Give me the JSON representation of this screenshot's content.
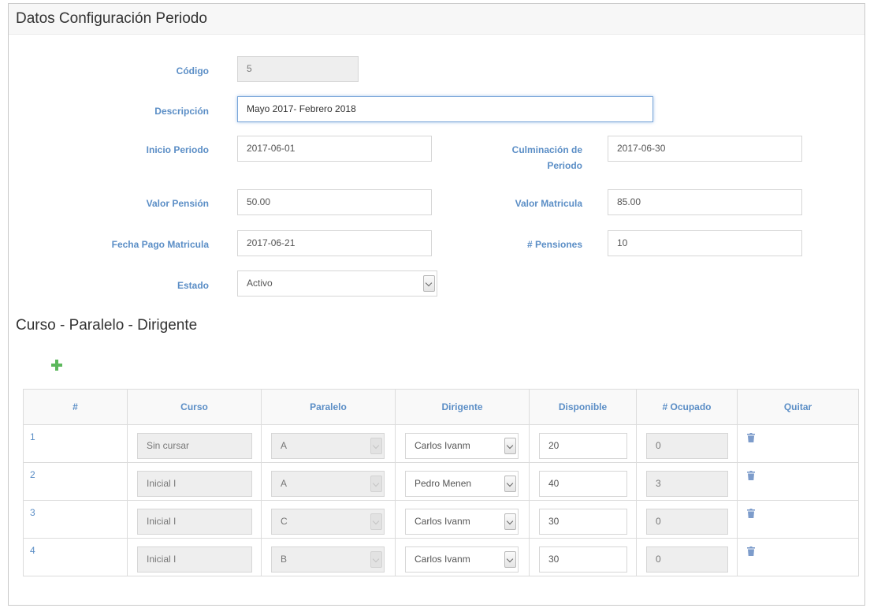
{
  "config": {
    "title": "Datos Configuración Periodo",
    "fields": {
      "codigo": {
        "label": "Código",
        "value": "5"
      },
      "descripcion": {
        "label": "Descripción",
        "value": "Mayo 2017- Febrero 2018"
      },
      "inicio": {
        "label": "Inicio Periodo",
        "value": "2017-06-01"
      },
      "culminacion": {
        "label_line1": "Culminación de",
        "label_line2": "Periodo",
        "value": "2017-06-30"
      },
      "valor_pension": {
        "label": "Valor Pensión",
        "value": "50.00"
      },
      "valor_matricula": {
        "label": "Valor Matricula",
        "value": "85.00"
      },
      "fecha_pago": {
        "label": "Fecha Pago Matricula",
        "value": "2017-06-21"
      },
      "pensiones": {
        "label": "# Pensiones",
        "value": "10"
      },
      "estado": {
        "label": "Estado",
        "value": "Activo"
      }
    }
  },
  "courses": {
    "title": "Curso - Paralelo - Dirigente",
    "add_icon": "plus-icon",
    "delete_icon": "trash-icon",
    "accent_color": "#5b8ec6",
    "add_color": "#5cb85c",
    "columns": [
      "#",
      "Curso",
      "Paralelo",
      "Dirigente",
      "Disponible",
      "# Ocupado",
      "Quitar"
    ],
    "rows": [
      {
        "num": "1",
        "curso": "Sin cursar",
        "paralelo": "A",
        "dirigente": "Carlos Ivanm",
        "disponible": "20",
        "ocupado": "0"
      },
      {
        "num": "2",
        "curso": "Inicial I",
        "paralelo": "A",
        "dirigente": "Pedro Menen",
        "disponible": "40",
        "ocupado": "3"
      },
      {
        "num": "3",
        "curso": "Inicial I",
        "paralelo": "C",
        "dirigente": "Carlos Ivanm",
        "disponible": "30",
        "ocupado": "0"
      },
      {
        "num": "4",
        "curso": "Inicial I",
        "paralelo": "B",
        "dirigente": "Carlos Ivanm",
        "disponible": "30",
        "ocupado": "0"
      }
    ]
  }
}
